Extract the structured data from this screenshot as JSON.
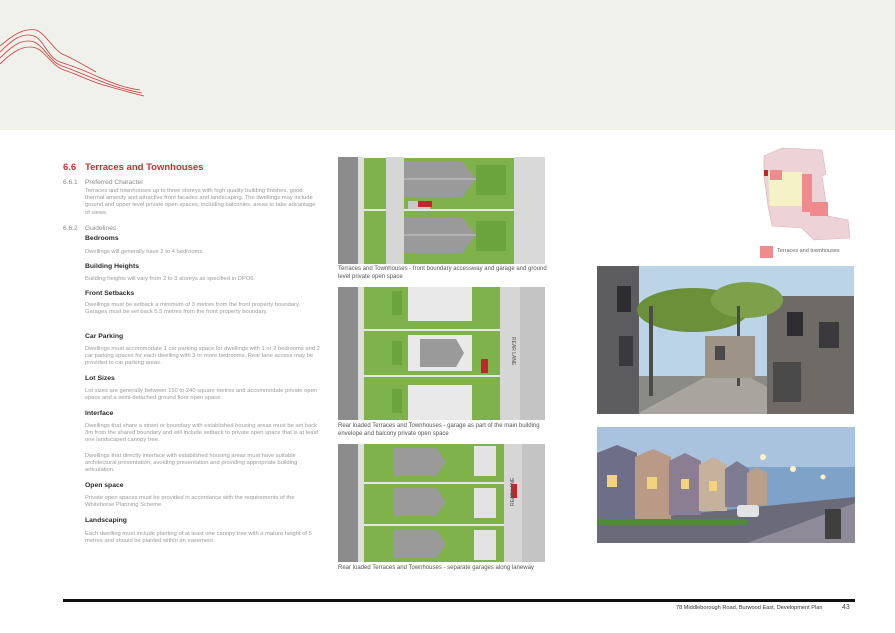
{
  "section": {
    "number": "6.6",
    "title": "Terraces and Townhouses"
  },
  "preferred": {
    "number": "6.6.1",
    "heading": "Preferred Character",
    "text": "Terraces and townhouses up to three storeys with high quality building finishes, good thermal amenity and attractive front facades and landscaping. The dwellings may include ground and upper level private open spaces, including balconies, areas to take advantage of views."
  },
  "guidelines": {
    "number": "6.6.2",
    "heading": "Guidelines",
    "items": [
      {
        "heading": "Bedrooms",
        "text": "Dwellings will generally have 2 to 4 bedrooms."
      },
      {
        "heading": "Building Heights",
        "text": "Building heights will vary from 2 to 3 storeys as specified in DPO6."
      },
      {
        "heading": "Front Setbacks",
        "text": "Dwellings must be setback a minimum of 3 metres from the front property boundary. Garages must be set back 5.5 metres from the front property boundary."
      },
      {
        "heading": "Car Parking",
        "text": "Dwellings must accommodate 1 car parking space for dwellings with 1 or 2 bedrooms and 2 car parking spaces for each dwelling with 3 or more bedrooms. Rear lane access may be provided to car parking areas."
      },
      {
        "heading": "Lot Sizes",
        "text": "Lot sizes are generally between 150 to 240 square metres and accommodate private open space and a semi-detached ground floor open space."
      },
      {
        "heading": "Interface",
        "text": "Dwellings that share a street or boundary with established housing areas must be set back 3m from the shared boundary and will include setback to private open space that is at least one landscaped canopy tree."
      },
      {
        "heading": "",
        "text": "Dwellings that directly interface with established housing areas must have suitable architectural presentation, avoiding presentation and providing appropriate building articulation."
      },
      {
        "heading": "Open space",
        "text": "Private open spaces must be provided in accordance with the requirements of the Whitehorse Planning Scheme."
      },
      {
        "heading": "Landscaping",
        "text": "Each dwelling must include planting of at least one canopy tree with a mature height of 5 metres and should be planted within an easement."
      }
    ]
  },
  "captions": [
    "Terraces and Townhouses - front boundary accessway and garage and ground level private open space",
    "Rear loaded Terraces and Townhouses - garage as part of the main building envelope and balcony private open space",
    "Rear loaded Terraces and Townhouses - separate garages along laneway"
  ],
  "plan_labels": {
    "rear_lane": "REAR LANE"
  },
  "legend": {
    "label": "Terraces and townhouses",
    "color": "#ef8a8f"
  },
  "footer": {
    "text": "78 Middleborough Road, Burwood East, Development Plan",
    "page": "43"
  }
}
